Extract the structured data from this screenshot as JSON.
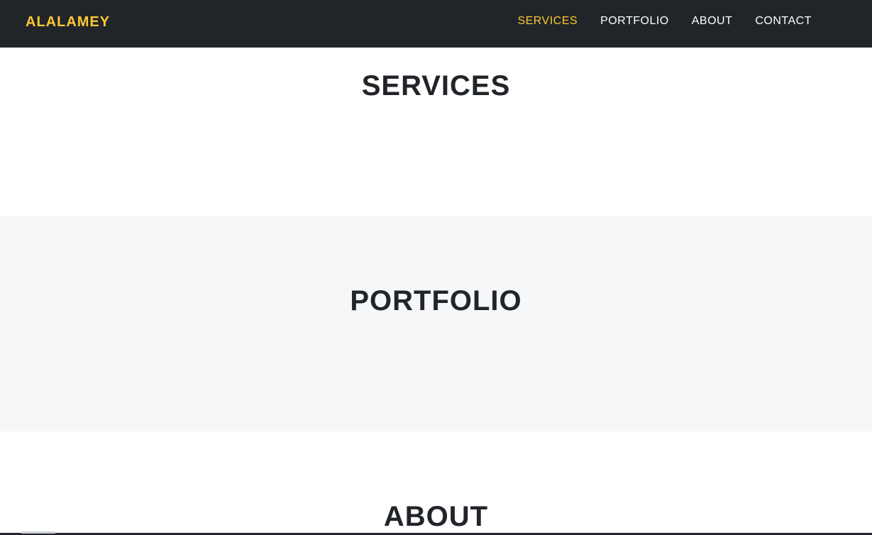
{
  "colors": {
    "navbar_bg": "#212529",
    "brand": "#fec832",
    "nav_active": "#fec832",
    "nav_default": "#ffffff",
    "heading": "#212529",
    "alt_section_bg": "#f6f7f9"
  },
  "navbar": {
    "brand": "ALALAMEY",
    "links": [
      {
        "label": "SERVICES",
        "active": true
      },
      {
        "label": "PORTFOLIO",
        "active": false
      },
      {
        "label": "ABOUT",
        "active": false
      },
      {
        "label": "CONTACT",
        "active": false
      }
    ]
  },
  "sections": {
    "services": {
      "title": "SERVICES"
    },
    "portfolio": {
      "title": "PORTFOLIO"
    },
    "about": {
      "title": "ABOUT"
    }
  }
}
